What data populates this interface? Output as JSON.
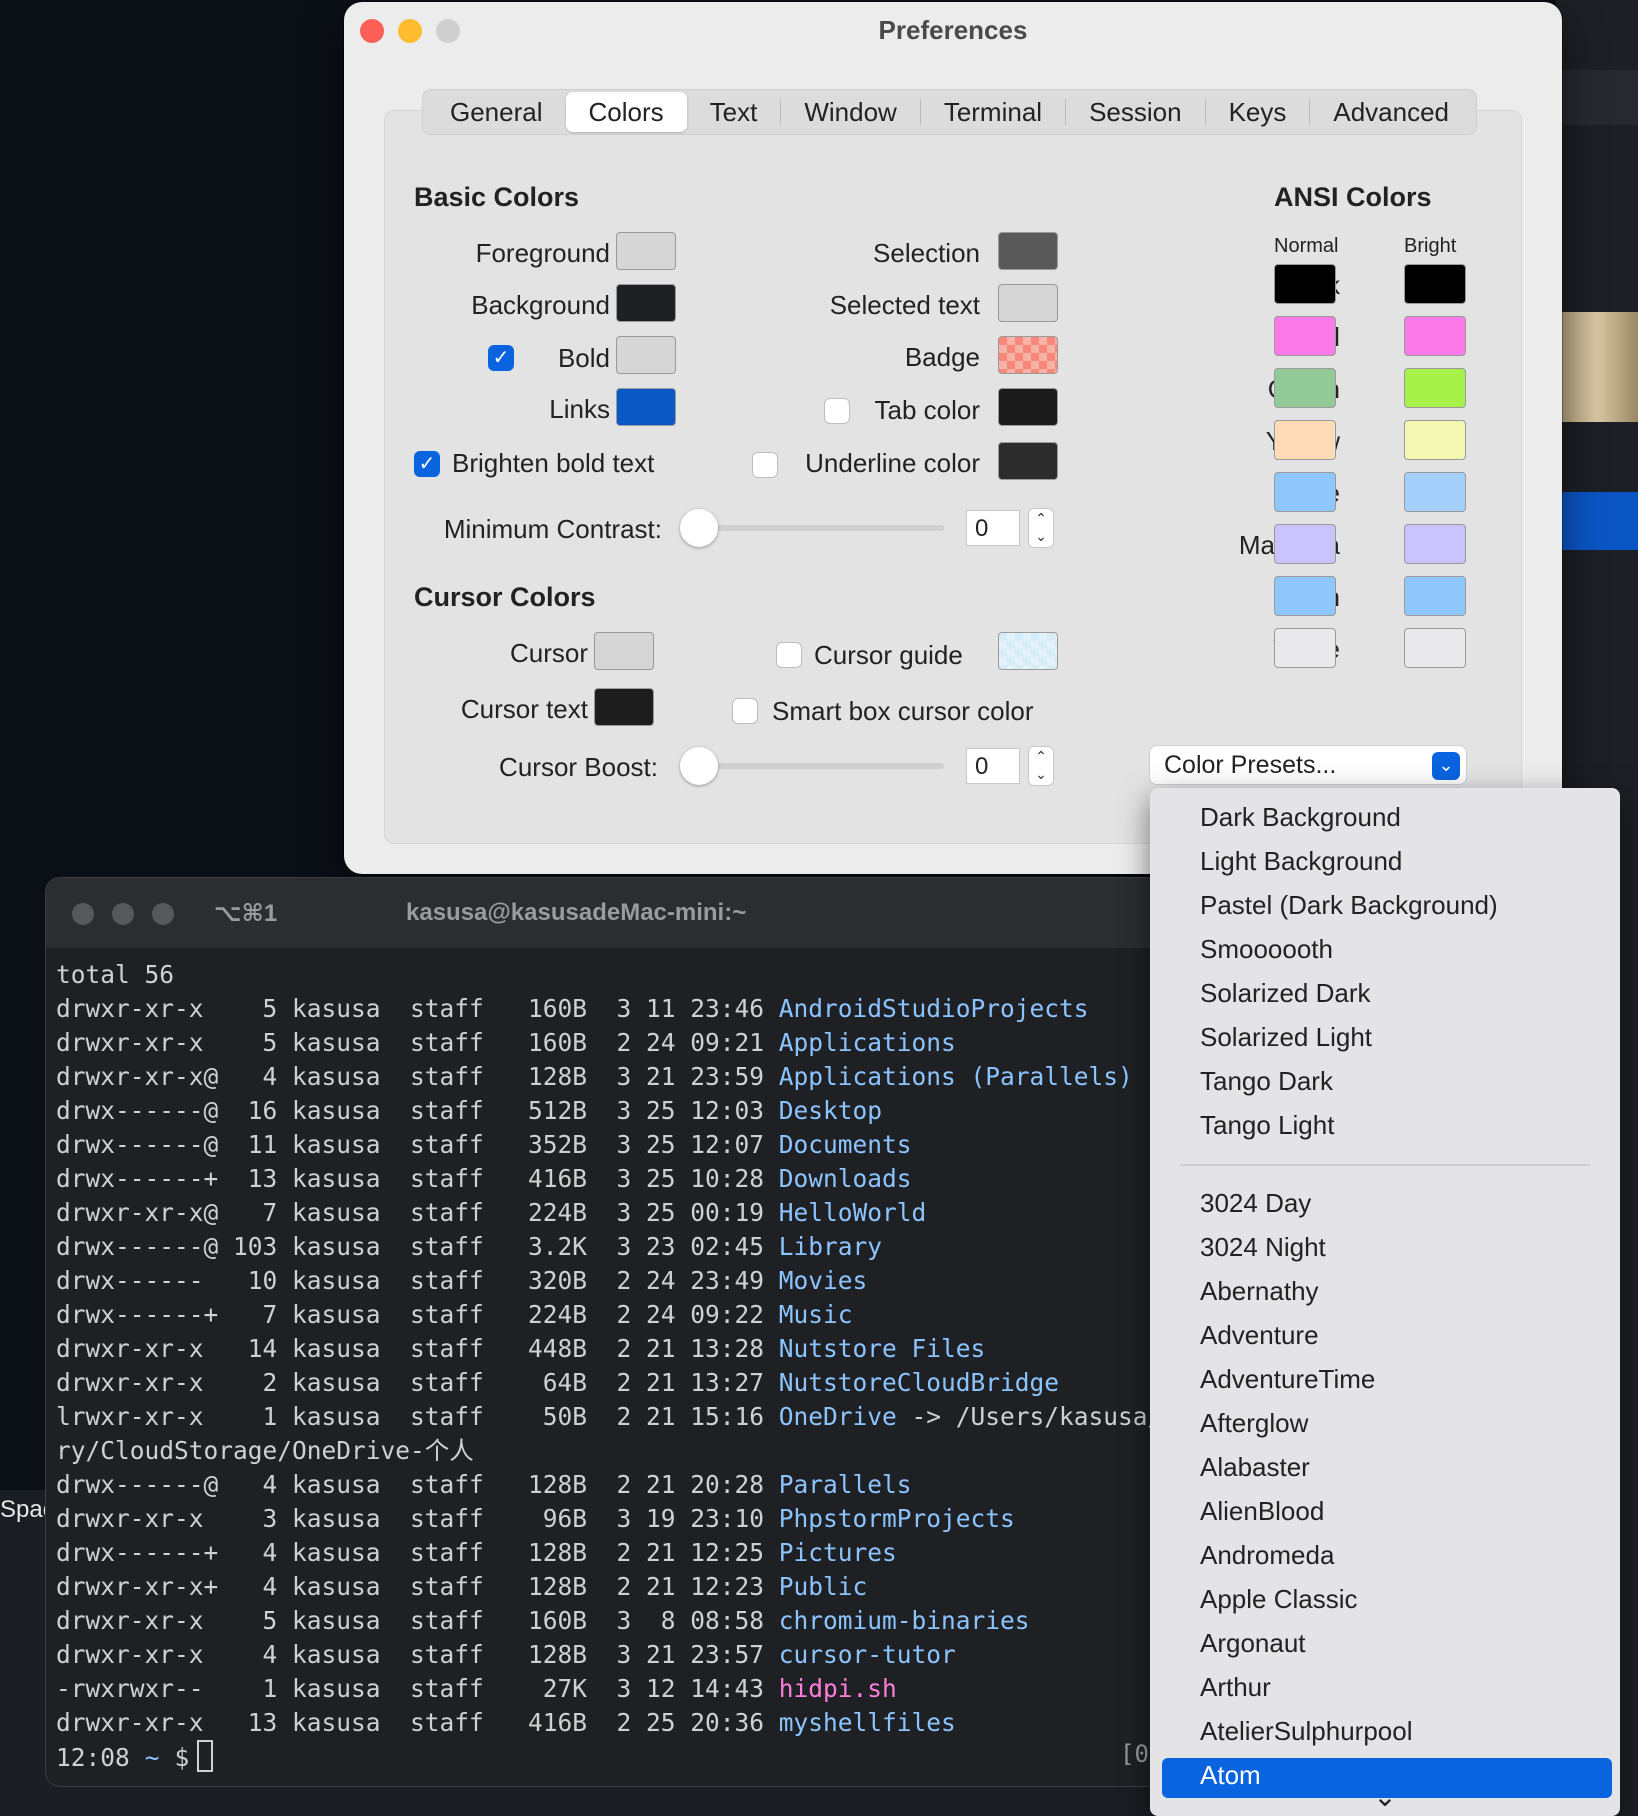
{
  "desktop": {
    "partial_label": "Spac"
  },
  "prefs": {
    "title": "Preferences",
    "tabs": [
      "General",
      "Colors",
      "Text",
      "Window",
      "Terminal",
      "Session",
      "Keys",
      "Advanced"
    ],
    "active_tab": "Colors",
    "basic": {
      "heading": "Basic Colors",
      "foreground": "Foreground",
      "background": "Background",
      "bold": "Bold",
      "links": "Links",
      "selection": "Selection",
      "selected_text": "Selected text",
      "badge": "Badge",
      "tab_color": "Tab color",
      "brighten": "Brighten bold text",
      "underline": "Underline color",
      "min_contrast": "Minimum Contrast:",
      "min_contrast_value": "0"
    },
    "cursor": {
      "heading": "Cursor Colors",
      "cursor": "Cursor",
      "cursor_text": "Cursor text",
      "cursor_guide": "Cursor guide",
      "smart_box": "Smart box cursor color",
      "boost": "Cursor Boost:",
      "boost_value": "0"
    },
    "ansi": {
      "heading": "ANSI Colors",
      "normal": "Normal",
      "bright": "Bright",
      "names": [
        "Black",
        "Red",
        "Green",
        "Yellow",
        "Blue",
        "Magenta",
        "Cyan",
        "White"
      ],
      "normal_colors": [
        "#000000",
        "#fb7ae8",
        "#92c996",
        "#ffdbb8",
        "#8fc6fb",
        "#c9c4fd",
        "#8fc6fb",
        "#e9e9eb"
      ],
      "bright_colors": [
        "#000000",
        "#fb7ae8",
        "#a6f24a",
        "#f4f8b3",
        "#a3d1fc",
        "#c9c4fd",
        "#8fc6fb",
        "#e9e9eb"
      ]
    },
    "presets_label": "Color Presets...",
    "colors": {
      "foreground": "#d6d6d6",
      "background": "#1d2022",
      "bold": "#d6d6d6",
      "links": "#0a57c6",
      "selection": "#595959",
      "selected_text": "#d6d6d6",
      "badge": "#f6887a",
      "tab": "#1b1b1b",
      "underline": "#2c2c2c",
      "cursor": "#d6d6d6",
      "cursor_text": "#1d1d1d",
      "cursor_guide": "#d6ecf8",
      "accent": "#0a64e0"
    }
  },
  "terminal": {
    "shortcut": "⌥⌘1",
    "title": "kasusa@kasusadeMac-mini:~",
    "total": "total 56",
    "rows": [
      {
        "prefix": "drwxr-xr-x    5 kasusa  staff   160B  3 11 23:46 ",
        "name": "AndroidStudioProjects",
        "kind": "dir"
      },
      {
        "prefix": "drwxr-xr-x    5 kasusa  staff   160B  2 24 09:21 ",
        "name": "Applications",
        "kind": "dir"
      },
      {
        "prefix": "drwxr-xr-x@   4 kasusa  staff   128B  3 21 23:59 ",
        "name": "Applications (Parallels)",
        "kind": "dir"
      },
      {
        "prefix": "drwx------@  16 kasusa  staff   512B  3 25 12:03 ",
        "name": "Desktop",
        "kind": "dir"
      },
      {
        "prefix": "drwx------@  11 kasusa  staff   352B  3 25 12:07 ",
        "name": "Documents",
        "kind": "dir"
      },
      {
        "prefix": "drwx------+  13 kasusa  staff   416B  3 25 10:28 ",
        "name": "Downloads",
        "kind": "dir"
      },
      {
        "prefix": "drwxr-xr-x@   7 kasusa  staff   224B  3 25 00:19 ",
        "name": "HelloWorld",
        "kind": "dir"
      },
      {
        "prefix": "drwx------@ 103 kasusa  staff   3.2K  3 23 02:45 ",
        "name": "Library",
        "kind": "dir"
      },
      {
        "prefix": "drwx------   10 kasusa  staff   320B  2 24 23:49 ",
        "name": "Movies",
        "kind": "dir"
      },
      {
        "prefix": "drwx------+   7 kasusa  staff   224B  2 24 09:22 ",
        "name": "Music",
        "kind": "dir"
      },
      {
        "prefix": "drwxr-xr-x   14 kasusa  staff   448B  2 21 13:28 ",
        "name": "Nutstore Files",
        "kind": "dir"
      },
      {
        "prefix": "drwxr-xr-x    2 kasusa  staff    64B  2 21 13:27 ",
        "name": "NutstoreCloudBridge",
        "kind": "dir"
      },
      {
        "prefix": "lrwxr-xr-x    1 kasusa  staff    50B  2 21 15:16 ",
        "name": "OneDrive",
        "kind": "lnk",
        "suffix": " -> /Users/kasusa/Lib"
      },
      {
        "prefix": "ry/CloudStorage/OneDrive-个人",
        "name": "",
        "kind": "plain"
      },
      {
        "prefix": "drwx------@   4 kasusa  staff   128B  2 21 20:28 ",
        "name": "Parallels",
        "kind": "dir"
      },
      {
        "prefix": "drwxr-xr-x    3 kasusa  staff    96B  3 19 23:10 ",
        "name": "PhpstormProjects",
        "kind": "dir"
      },
      {
        "prefix": "drwx------+   4 kasusa  staff   128B  2 21 12:25 ",
        "name": "Pictures",
        "kind": "dir"
      },
      {
        "prefix": "drwxr-xr-x+   4 kasusa  staff   128B  2 21 12:23 ",
        "name": "Public",
        "kind": "dir"
      },
      {
        "prefix": "drwxr-xr-x    5 kasusa  staff   160B  3  8 08:58 ",
        "name": "chromium-binaries",
        "kind": "dir"
      },
      {
        "prefix": "drwxr-xr-x    4 kasusa  staff   128B  3 21 23:57 ",
        "name": "cursor-tutor",
        "kind": "dir"
      },
      {
        "prefix": "-rwxrwxr--    1 kasusa  staff    27K  3 12 14:43 ",
        "name": "hidpi.sh",
        "kind": "exe"
      },
      {
        "prefix": "drwxr-xr-x   13 kasusa  staff   416B  2 25 20:36 ",
        "name": "myshellfiles",
        "kind": "dir"
      }
    ],
    "prompt_time": "12:08",
    "prompt_path": "~",
    "prompt_symbol": "$",
    "right_fragment": "[0"
  },
  "menu": {
    "group1": [
      "Dark Background",
      "Light Background",
      "Pastel (Dark Background)",
      "Smoooooth",
      "Solarized Dark",
      "Solarized Light",
      "Tango Dark",
      "Tango Light"
    ],
    "group2": [
      "3024 Day",
      "3024 Night",
      "Abernathy",
      "Adventure",
      "AdventureTime",
      "Afterglow",
      "Alabaster",
      "AlienBlood",
      "Andromeda",
      "Apple Classic",
      "Argonaut",
      "Arthur",
      "AtelierSulphurpool",
      "Atom"
    ],
    "highlighted": "Atom",
    "scroll_arrow": "⌄"
  }
}
